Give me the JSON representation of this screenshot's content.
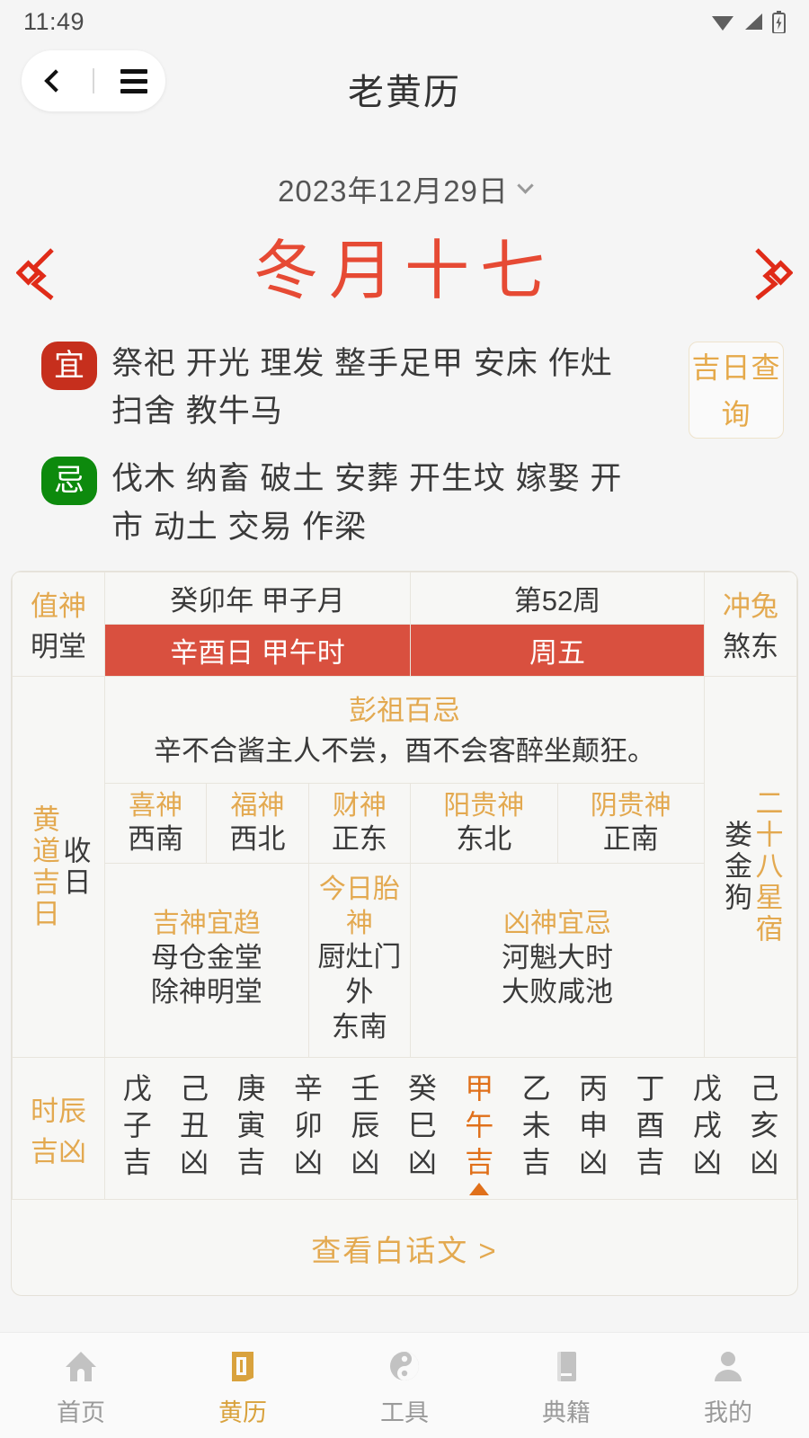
{
  "statusbar": {
    "time": "11:49",
    "icons": [
      "wifi-icon",
      "signal-icon",
      "battery-charging-icon"
    ]
  },
  "appbar": {
    "title": "老黄历",
    "back_icon": "chevron-left-icon",
    "menu_icon": "hamburger-menu-icon"
  },
  "date": {
    "gregorian": "2023年12月29日",
    "dropdown_icon": "chevron-down-icon",
    "lunar": "冬月十七",
    "ornament_left": "ornament-left-icon",
    "ornament_right": "ornament-right-icon",
    "lunar_color": "#e64a34"
  },
  "yiji": {
    "yi_label": "宜",
    "yi_color": "#c62f1d",
    "yi_items": "祭祀 开光 理发 整手足甲 安床 作灶 扫舍 教牛马",
    "ji_label": "忌",
    "ji_color": "#0d8a0d",
    "ji_items": "伐木 纳畜 破土 安葬 开生坟 嫁娶 开市 动土 交易 作梁",
    "lucky_day_button": "吉日查询"
  },
  "table": {
    "left_top_title": "值神",
    "left_top_value": "明堂",
    "left_mid_title": "黄道吉日",
    "left_mid_value": "收日",
    "right_top_title": "冲兔",
    "right_top_value": "煞东",
    "right_mid_title": "二十八星宿",
    "right_mid_value": "娄金狗",
    "ganzhi_year_month": "癸卯年 甲子月",
    "week_number": "第52周",
    "ganzhi_day_hour": "辛酉日 甲午时",
    "weekday": "周五",
    "header_red": "#d9503f",
    "pengzu_title": "彭祖百忌",
    "pengzu_text": "辛不合酱主人不尝，酉不会客醉坐颠狂。",
    "gods": [
      {
        "title": "喜神",
        "value": "西南"
      },
      {
        "title": "福神",
        "value": "西北"
      },
      {
        "title": "财神",
        "value": "正东"
      },
      {
        "title": "阳贵神",
        "value": "东北"
      },
      {
        "title": "阴贵神",
        "value": "正南"
      }
    ],
    "blocks": [
      {
        "title": "吉神宜趋",
        "line1": "母仓金堂",
        "line2": "除神明堂"
      },
      {
        "title": "今日胎神",
        "line1": "厨灶门 外",
        "line2": "东南"
      },
      {
        "title": "凶神宜忌",
        "line1": "河魁大时",
        "line2": "大败咸池"
      }
    ],
    "shichen_label_line1": "时辰",
    "shichen_label_line2": "吉凶",
    "shichen": [
      {
        "gan": "戊",
        "zhi": "子",
        "luck": "吉",
        "active": false
      },
      {
        "gan": "己",
        "zhi": "丑",
        "luck": "凶",
        "active": false
      },
      {
        "gan": "庚",
        "zhi": "寅",
        "luck": "吉",
        "active": false
      },
      {
        "gan": "辛",
        "zhi": "卯",
        "luck": "凶",
        "active": false
      },
      {
        "gan": "壬",
        "zhi": "辰",
        "luck": "凶",
        "active": false
      },
      {
        "gan": "癸",
        "zhi": "巳",
        "luck": "凶",
        "active": false
      },
      {
        "gan": "甲",
        "zhi": "午",
        "luck": "吉",
        "active": true
      },
      {
        "gan": "乙",
        "zhi": "未",
        "luck": "吉",
        "active": false
      },
      {
        "gan": "丙",
        "zhi": "申",
        "luck": "凶",
        "active": false
      },
      {
        "gan": "丁",
        "zhi": "酉",
        "luck": "吉",
        "active": false
      },
      {
        "gan": "戊",
        "zhi": "戌",
        "luck": "凶",
        "active": false
      },
      {
        "gan": "己",
        "zhi": "亥",
        "luck": "凶",
        "active": false
      }
    ],
    "baihua_link": "查看白话文 >"
  },
  "bottomnav": {
    "items": [
      {
        "label": "首页",
        "icon": "home-icon",
        "active": false
      },
      {
        "label": "黄历",
        "icon": "almanac-icon",
        "active": true
      },
      {
        "label": "工具",
        "icon": "yinyang-icon",
        "active": false
      },
      {
        "label": "典籍",
        "icon": "book-icon",
        "active": false
      },
      {
        "label": "我的",
        "icon": "person-icon",
        "active": false
      }
    ],
    "active_color": "#d9a23d"
  }
}
